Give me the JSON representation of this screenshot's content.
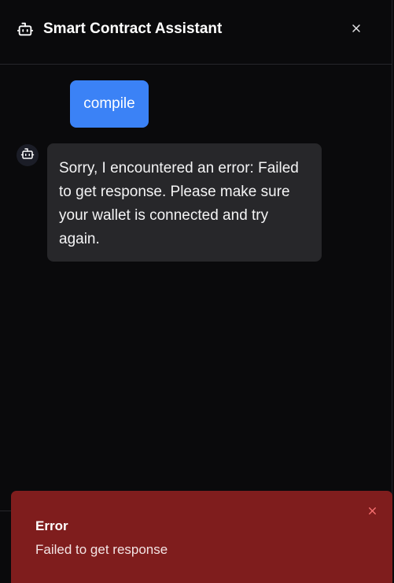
{
  "header": {
    "title": "Smart Contract Assistant",
    "icon": "bot-icon",
    "close_icon": "close-icon"
  },
  "messages": [
    {
      "role": "user",
      "text": "compile"
    },
    {
      "role": "assistant",
      "icon": "bot-icon",
      "text": "Sorry, I encountered an error: Failed to get response. Please make sure your wallet is connected and try again."
    }
  ],
  "toast": {
    "title": "Error",
    "description": "Failed to get response",
    "close_icon": "close-icon"
  },
  "colors": {
    "background": "#0a0a0c",
    "user_bubble": "#3b82f6",
    "assistant_bubble": "#27272a",
    "toast_background": "#7f1d1d",
    "toast_close": "#f87171"
  }
}
